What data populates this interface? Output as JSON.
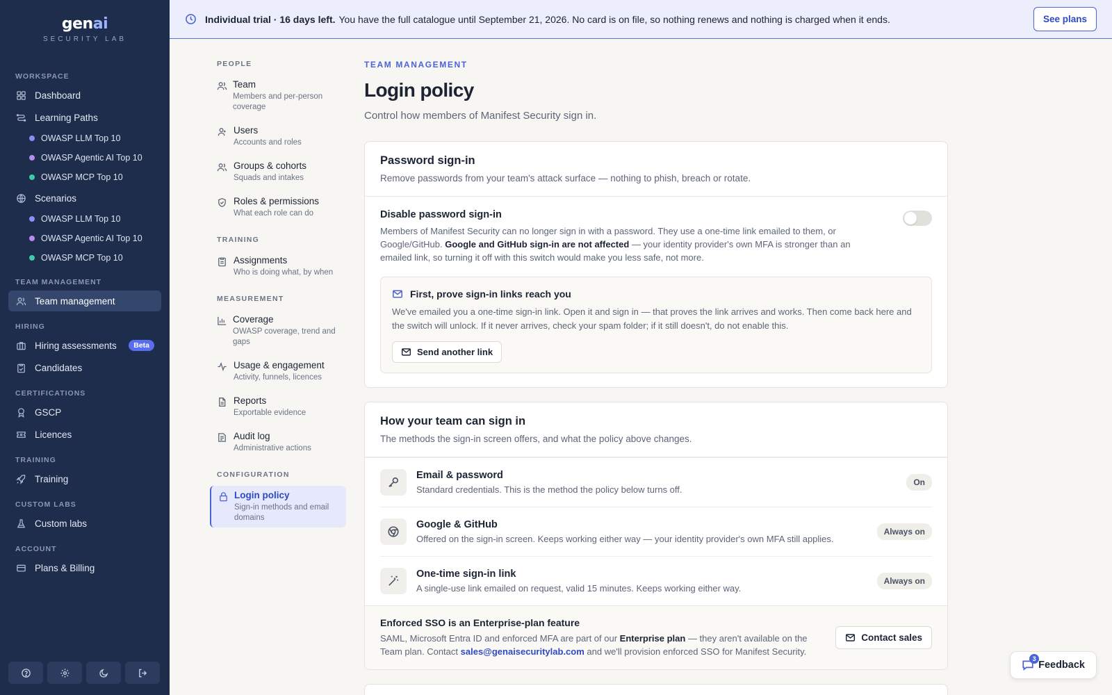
{
  "brand": {
    "name_main": "gen",
    "name_accent": "ai",
    "tagline": "SECURITY LAB"
  },
  "sidebar": {
    "sections": {
      "workspace": "WORKSPACE",
      "team_management": "TEAM MANAGEMENT",
      "hiring": "HIRING",
      "certifications": "CERTIFICATIONS",
      "training": "TRAINING",
      "custom_labs": "CUSTOM LABS",
      "account": "ACCOUNT"
    },
    "items": {
      "dashboard": "Dashboard",
      "learning_paths": "Learning Paths",
      "lp_llm": "OWASP LLM Top 10",
      "lp_agentic": "OWASP Agentic AI Top 10",
      "lp_mcp": "OWASP MCP Top 10",
      "scenarios": "Scenarios",
      "sc_llm": "OWASP LLM Top 10",
      "sc_agentic": "OWASP Agentic AI Top 10",
      "sc_mcp": "OWASP MCP Top 10",
      "team_management": "Team management",
      "hiring_assessments": "Hiring assessments",
      "hiring_badge": "Beta",
      "candidates": "Candidates",
      "gscp": "GSCP",
      "licences": "Licences",
      "training": "Training",
      "custom_labs": "Custom labs",
      "plans_billing": "Plans & Billing"
    },
    "dot_colors": {
      "llm": "#8b8ff5",
      "agentic": "#b58cf0",
      "mcp": "#3ec9a7"
    }
  },
  "banner": {
    "strong": "Individual trial · 16 days left.",
    "text": "You have the full catalogue until September 21, 2026. No card is on file, so nothing renews and nothing is charged when it ends.",
    "button": "See plans"
  },
  "subnav": {
    "people": "PEOPLE",
    "team_title": "Team",
    "team_desc": "Members and per-person coverage",
    "users_title": "Users",
    "users_desc": "Accounts and roles",
    "groups_title": "Groups & cohorts",
    "groups_desc": "Squads and intakes",
    "roles_title": "Roles & permissions",
    "roles_desc": "What each role can do",
    "training": "TRAINING",
    "assign_title": "Assignments",
    "assign_desc": "Who is doing what, by when",
    "measurement": "MEASUREMENT",
    "coverage_title": "Coverage",
    "coverage_desc": "OWASP coverage, trend and gaps",
    "usage_title": "Usage & engagement",
    "usage_desc": "Activity, funnels, licences",
    "reports_title": "Reports",
    "reports_desc": "Exportable evidence",
    "audit_title": "Audit log",
    "audit_desc": "Administrative actions",
    "configuration": "CONFIGURATION",
    "login_title": "Login policy",
    "login_desc": "Sign-in methods and email domains"
  },
  "main": {
    "eyebrow": "TEAM MANAGEMENT",
    "title": "Login policy",
    "subtitle": "Control how members of Manifest Security sign in.",
    "password_card": {
      "title": "Password sign-in",
      "desc": "Remove passwords from your team's attack surface — nothing to phish, breach or rotate.",
      "setting_title": "Disable password sign-in",
      "setting_desc_1": "Members of Manifest Security can no longer sign in with a password. They use a one-time link emailed to them, or Google/GitHub.",
      "setting_desc_bold": "Google and GitHub sign-in are not affected",
      "setting_desc_2": "— your identity provider's own MFA is stronger than an emailed link, so turning it off with this switch would make you less safe, not more.",
      "toggle_on": false,
      "verify_title": "First, prove sign-in links reach you",
      "verify_desc": "We've emailed you a one-time sign-in link. Open it and sign in — that proves the link arrives and works. Then come back here and the switch will unlock. If it never arrives, check your spam folder; if it still doesn't, do not enable this.",
      "verify_button": "Send another link"
    },
    "methods_card": {
      "title": "How your team can sign in",
      "desc": "The methods the sign-in screen offers, and what the policy above changes.",
      "methods": [
        {
          "title": "Email & password",
          "desc": "Standard credentials. This is the method the policy below turns off.",
          "status": "On"
        },
        {
          "title": "Google & GitHub",
          "desc": "Offered on the sign-in screen. Keeps working either way — your identity provider's own MFA still applies.",
          "status": "Always on"
        },
        {
          "title": "One-time sign-in link",
          "desc": "A single-use link emailed on request, valid 15 minutes. Keeps working either way.",
          "status": "Always on"
        }
      ],
      "sso_title": "Enforced SSO is an Enterprise-plan feature",
      "sso_desc_1": "SAML, Microsoft Entra ID and enforced MFA are part of our",
      "sso_desc_bold": "Enterprise plan",
      "sso_desc_2": "— they aren't available on the Team plan. Contact",
      "sso_email": "sales@genaisecuritylab.com",
      "sso_desc_3": "and we'll provision enforced SSO for Manifest Security.",
      "sso_button": "Contact sales"
    }
  },
  "feedback": {
    "label": "Feedback",
    "count": "3"
  }
}
